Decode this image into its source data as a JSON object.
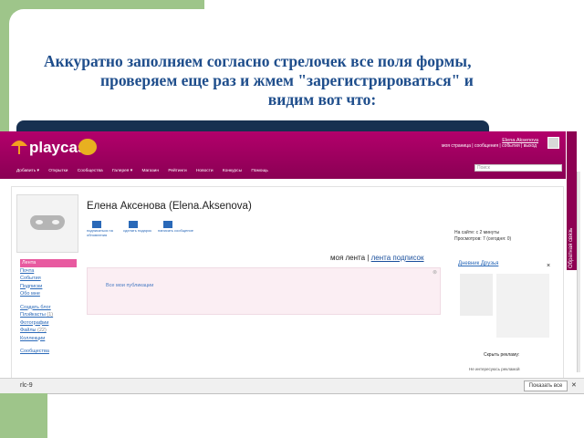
{
  "slide": {
    "heading_line1": "Аккуратно заполняем согласно стрелочек все поля формы,",
    "heading_line2": "проверяем еще раз и жмем \"зарегистрироваться\" и",
    "heading_line3": "видим вот что:"
  },
  "site": {
    "logo": "playcast",
    "user_link": "Elena.Aksenova",
    "user_menu": "моя страница | сообщения | события | выход",
    "nav": [
      "Добавить ▾",
      "Открытки",
      "Сообщества",
      "Галерея ▾",
      "Магазин",
      "Рейтинги",
      "Новости",
      "Конкурсы",
      "Помощь"
    ],
    "search_placeholder": "Поиск",
    "feedback": "Обратная связь"
  },
  "profile": {
    "name": "Елена Аксенова (Elena.Aksenova)",
    "icons": [
      {
        "icon": "rss-icon",
        "label": "подписаться на обновления"
      },
      {
        "icon": "gift-icon",
        "label": "сделать подарок"
      },
      {
        "icon": "message-icon",
        "label": "написать сообщение"
      }
    ],
    "stats_line1": "На сайте: с 2 минуты",
    "stats_line2": "Просмотров: 7 (сегодня: 0)"
  },
  "feed": {
    "tab_active": "моя лента",
    "tab_other": "лента подписок",
    "empty_link": "Все мои публикации"
  },
  "sidebar": {
    "items": [
      {
        "label": "Лента"
      },
      {
        "label": "Почта"
      },
      {
        "label": "События"
      },
      {
        "label": "Подписки"
      },
      {
        "label": "Обо мне"
      },
      {
        "label": "Создать блог"
      },
      {
        "label": "Плэйкасты",
        "count": "(1)"
      },
      {
        "label": "Фотографии"
      },
      {
        "label": "Файлы",
        "count": "(22)"
      },
      {
        "label": "Коллекции"
      },
      {
        "label": "Сообщества"
      }
    ]
  },
  "right_panel": {
    "title": "Дневник Друзья",
    "hide": "Скрыть рекламу:",
    "footer": "Не интересуюсь рекламой"
  },
  "taskbar": {
    "doc": "rlc-9",
    "button": "Показать все"
  }
}
